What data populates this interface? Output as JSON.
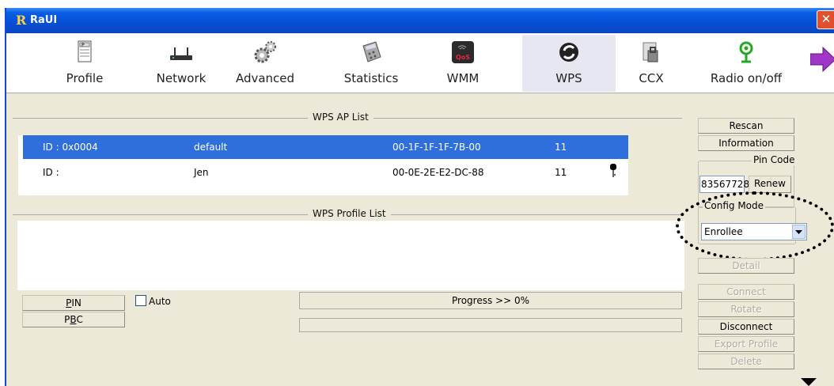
{
  "window": {
    "title": "RaUI",
    "logo": "R"
  },
  "toolbar": {
    "items": [
      {
        "label": "Profile",
        "icon": "profile-icon"
      },
      {
        "label": "Network",
        "icon": "network-icon"
      },
      {
        "label": "Advanced",
        "icon": "gears-icon"
      },
      {
        "label": "Statistics",
        "icon": "calculator-icon"
      },
      {
        "label": "WMM",
        "icon": "qos-icon"
      },
      {
        "label": "WPS",
        "icon": "wps-icon"
      },
      {
        "label": "CCX",
        "icon": "ccx-icon"
      },
      {
        "label": "Radio on/off",
        "icon": "radio-icon"
      }
    ],
    "active": "WPS"
  },
  "wps_ap_list": {
    "title": "WPS AP List",
    "rows": [
      {
        "id": "ID : 0x0004",
        "name": "default",
        "mac": "00-1F-1F-1F-7B-00",
        "channel": "11",
        "selected": true,
        "locked": false
      },
      {
        "id": "ID :",
        "name": "Jen",
        "mac": "00-0E-2E-E2-DC-88",
        "channel": "11",
        "selected": false,
        "locked": true
      }
    ]
  },
  "wps_profile_list": {
    "title": "WPS Profile List"
  },
  "buttons": {
    "pin": "PIN",
    "pbc": "PBC",
    "rescan": "Rescan",
    "information": "Information",
    "renew": "Renew",
    "detail": "Detail",
    "connect": "Connect",
    "rotate": "Rotate",
    "disconnect": "Disconnect",
    "export_profile": "Export Profile",
    "delete": "Delete"
  },
  "auto_label": "Auto",
  "progress": {
    "text": "Progress >> 0%",
    "value": 0
  },
  "pin_code": {
    "label": "Pin Code",
    "value": "83567728"
  },
  "config_mode": {
    "label": "Config Mode",
    "selected": "Enrollee"
  },
  "colors": {
    "selection": "#2f6fdb",
    "title_bar": "#0550d6",
    "panel": "#ece9d8"
  }
}
